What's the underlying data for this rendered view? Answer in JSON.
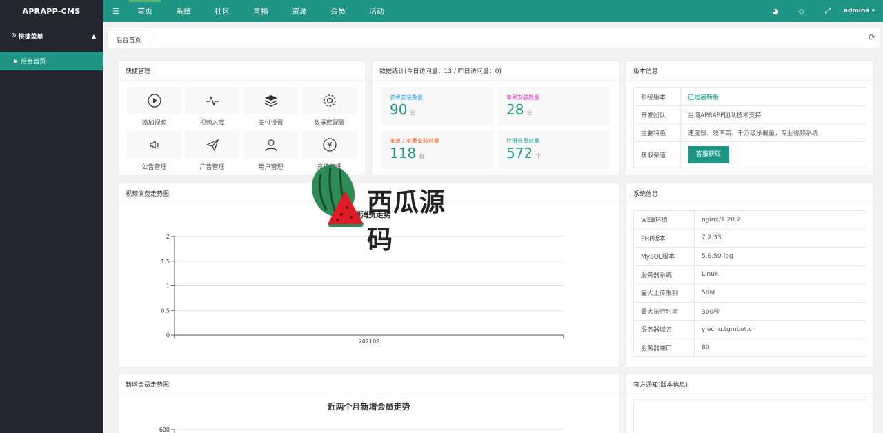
{
  "app": {
    "logo": "APRAPP-CMS"
  },
  "topnav": {
    "items": [
      "首页",
      "系统",
      "社区",
      "直播",
      "资源",
      "会员",
      "活动"
    ],
    "user": "admina"
  },
  "sidebar": {
    "section": "快捷菜单",
    "items": [
      "后台首页"
    ]
  },
  "tabs": {
    "active": "后台首页"
  },
  "quick": {
    "title": "快捷管理",
    "items": [
      {
        "label": "添加视频",
        "icon": "play-icon"
      },
      {
        "label": "视频入库",
        "icon": "pulse-icon"
      },
      {
        "label": "支付设置",
        "icon": "layers-icon"
      },
      {
        "label": "数据库配置",
        "icon": "gear-icon"
      },
      {
        "label": "公告管理",
        "icon": "speaker-icon"
      },
      {
        "label": "广告管理",
        "icon": "paper-plane-icon"
      },
      {
        "label": "用户管理",
        "icon": "user-icon"
      },
      {
        "label": "充值管理",
        "icon": "yen-icon"
      }
    ]
  },
  "stats": {
    "title": "数据统计(今日访问量：13 / 昨日访问量：0)",
    "items": [
      {
        "label": "安卓安装数量",
        "value": "90",
        "unit": "台",
        "color": "#1e9fff"
      },
      {
        "label": "苹果安装数量",
        "value": "28",
        "unit": "台",
        "color": "#e032c0"
      },
      {
        "label": "安卓 / 苹果安装总量",
        "value": "118",
        "unit": "台",
        "color": "#ff5722"
      },
      {
        "label": "注册会员总量",
        "value": "572",
        "unit": "个",
        "color": "#009688"
      }
    ]
  },
  "version": {
    "title": "版本信息",
    "rows": [
      {
        "k": "系统版本",
        "v": "已是最新版"
      },
      {
        "k": "开发团队",
        "v": "台湾APRAPP团队技术支持"
      },
      {
        "k": "主要特色",
        "v": "速度快、效率高、千万级承载量，专业视频系统"
      },
      {
        "k": "获取渠道",
        "v": "客服获取"
      }
    ]
  },
  "video_chart": {
    "card_title": "视频消费走势图"
  },
  "sysinfo": {
    "title": "系统信息",
    "rows": [
      {
        "k": "WEB环境",
        "v": "nginx/1.20.2"
      },
      {
        "k": "PHP版本",
        "v": "7.2.33"
      },
      {
        "k": "MySQL版本",
        "v": "5.6.50-log"
      },
      {
        "k": "服务器系统",
        "v": "Linux"
      },
      {
        "k": "最大上传限制",
        "v": "50M"
      },
      {
        "k": "最大执行时间",
        "v": "300秒"
      },
      {
        "k": "服务器域名",
        "v": "yiechu.tgmbot.cn"
      },
      {
        "k": "服务器端口",
        "v": "80"
      }
    ]
  },
  "member_chart": {
    "card_title": "新增会员走势图",
    "title": "近两个月新增会员走势",
    "y_top": "600"
  },
  "notice": {
    "title": "官方通知(版本信息)"
  },
  "watermark": {
    "text": "西瓜源码"
  },
  "chart_data": [
    {
      "type": "line",
      "title": "视频消费走势",
      "categories": [
        "202108"
      ],
      "series": [
        {
          "values": [
            2
          ]
        }
      ],
      "ylim": [
        0,
        2
      ],
      "yticks": [
        "0",
        "0.5",
        "1",
        "1.5",
        "2"
      ],
      "grid": true
    },
    {
      "type": "line",
      "title": "近两个月新增会员走势",
      "yticks": [
        "600"
      ],
      "grid": true
    }
  ]
}
